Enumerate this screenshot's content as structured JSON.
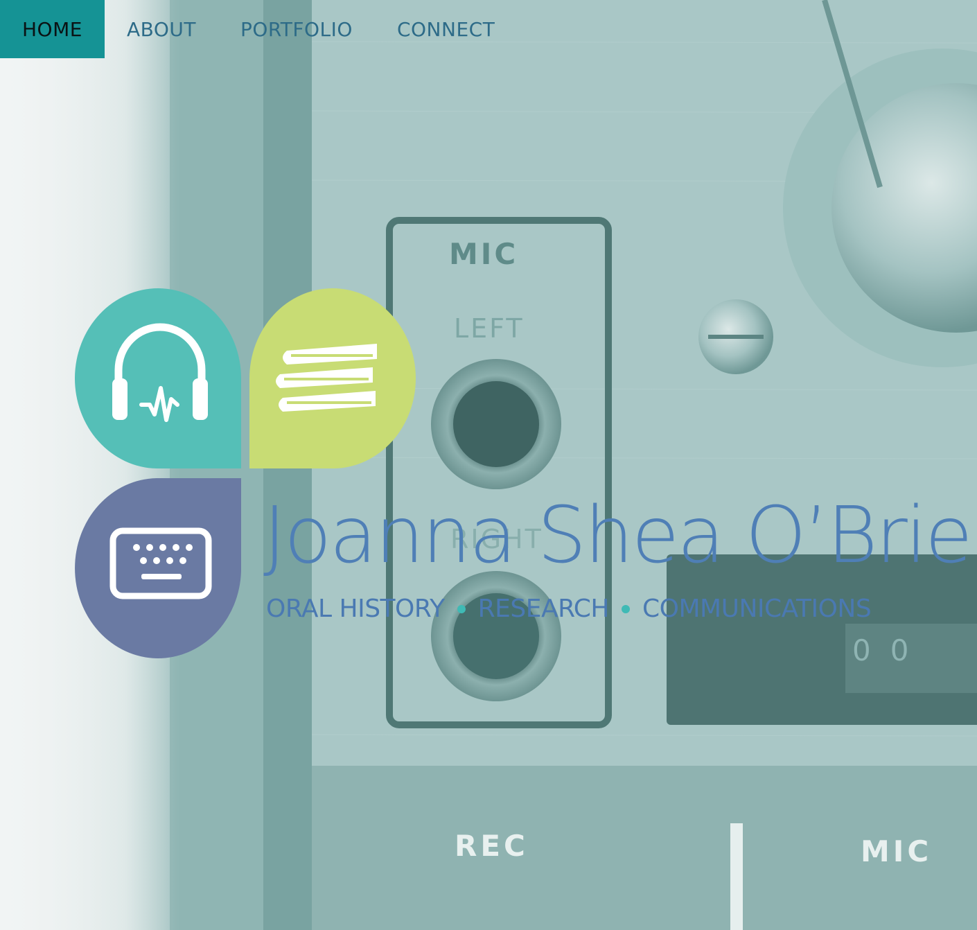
{
  "nav": {
    "items": [
      {
        "label": "HOME",
        "active": true
      },
      {
        "label": "ABOUT",
        "active": false
      },
      {
        "label": "PORTFOLIO",
        "active": false
      },
      {
        "label": "CONNECT",
        "active": false
      }
    ]
  },
  "logo": {
    "name": "Joanna Shea O’Brien",
    "tagline": {
      "part1": "ORAL HISTORY",
      "part2": "RESEARCH",
      "part3": "COMMUNICATIONS"
    },
    "icons": [
      "headphones-icon",
      "books-icon",
      "keyboard-icon"
    ],
    "colors": {
      "headphones_petal": "#55bfb7",
      "books_petal": "#c8dc74",
      "keyboard_petal": "#6a7aa3",
      "text": "#4f7fb6",
      "dot": "#3fbab5"
    }
  },
  "background": {
    "panel_labels": {
      "mic": "MIC",
      "left": "LEFT",
      "right": "RIGHT",
      "rec": "REC",
      "mic_bottom": "MIC",
      "digits": "00"
    }
  },
  "colors": {
    "nav_active_bg": "#159395",
    "nav_text": "#2d6b88",
    "nav_active_text": "#0a1214"
  }
}
